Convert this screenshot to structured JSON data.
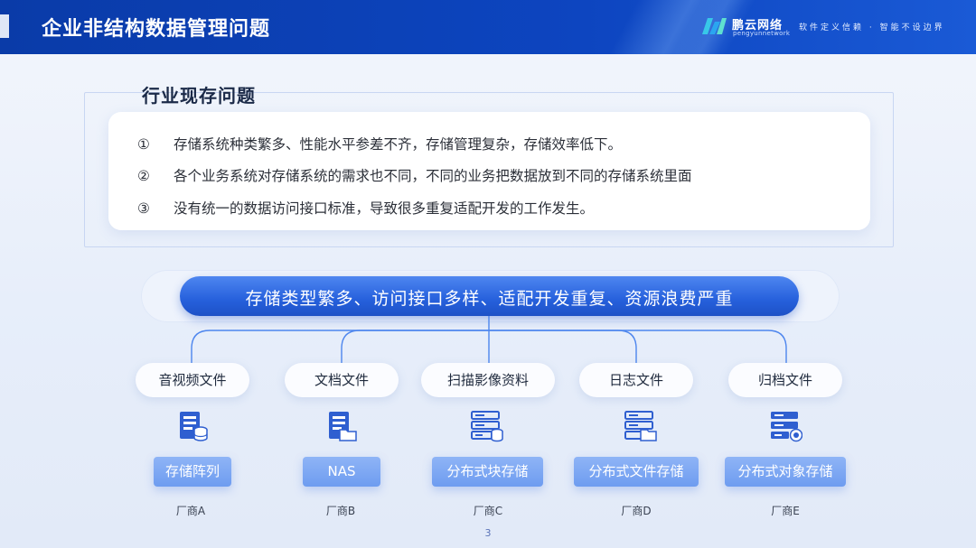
{
  "header": {
    "title": "企业非结构数据管理问题",
    "logo_name": "鹏云网络",
    "logo_sub": "pengyunnetwork",
    "slogan": "软件定义信赖 · 智能不设边界"
  },
  "problems": {
    "title": "行业现存问题",
    "items": [
      {
        "num": "①",
        "text": "存储系统种类繁多、性能水平参差不齐，存储管理复杂，存储效率低下。"
      },
      {
        "num": "②",
        "text": "各个业务系统对存储系统的需求也不同，不同的业务把数据放到不同的存储系统里面"
      },
      {
        "num": "③",
        "text": "没有统一的数据访问接口标准，导致很多重复适配开发的工作发生。"
      }
    ]
  },
  "banner": {
    "text": "存储类型繁多、访问接口多样、适配开发重复、资源浪费严重"
  },
  "columns": [
    {
      "category": "音视频文件",
      "icon": "server-db-icon",
      "system": "存储阵列",
      "vendor": "厂商A"
    },
    {
      "category": "文档文件",
      "icon": "server-folder-icon",
      "system": "NAS",
      "vendor": "厂商B"
    },
    {
      "category": "扫描影像资料",
      "icon": "server-rack-db-icon",
      "system": "分布式块存储",
      "vendor": "厂商C"
    },
    {
      "category": "日志文件",
      "icon": "server-rack-folder-icon",
      "system": "分布式文件存储",
      "vendor": "厂商D"
    },
    {
      "category": "归档文件",
      "icon": "server-rack-object-icon",
      "system": "分布式对象存储",
      "vendor": "厂商E"
    }
  ],
  "page_number": "3",
  "colors": {
    "header_blue": "#0d45c0",
    "banner_blue": "#2660dc",
    "button_blue": "#7ea8f3"
  }
}
